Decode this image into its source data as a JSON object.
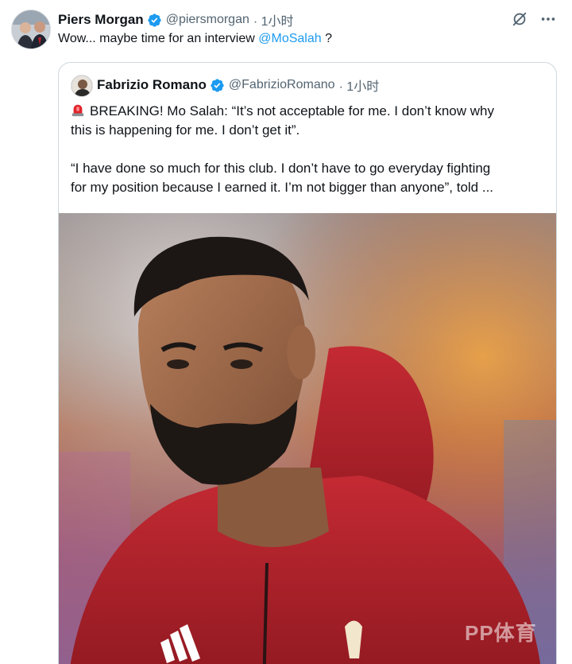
{
  "author": {
    "name": "Piers Morgan",
    "handle": "@piersmorgan",
    "time": "· 1小时",
    "verified": true
  },
  "tweet": {
    "text_before": "Wow... maybe time for an interview ",
    "mention": "@MoSalah",
    "text_after": " ?"
  },
  "actions": {
    "grok_icon": "grok-icon",
    "more_icon": "more-icon"
  },
  "quote": {
    "name": "Fabrizio Romano",
    "handle": "@FabrizioRomano",
    "time": "· 1小时",
    "verified": true,
    "emoji": "siren-icon",
    "line1": "BREAKING! Mo Salah: “It’s not acceptable for me. I don’t know why",
    "line2": "this is happening for me. I don’t get it”.",
    "line3": "“I have done so much for this club. I don’t have to go everyday fighting",
    "line4": "for my position because I earned it. I’m not bigger than anyone”, told ..."
  },
  "media": {
    "watermark": "PP体育"
  },
  "colors": {
    "accent": "#1d9bf0",
    "secondary_text": "#536471",
    "hoodie": "#b3212b"
  }
}
